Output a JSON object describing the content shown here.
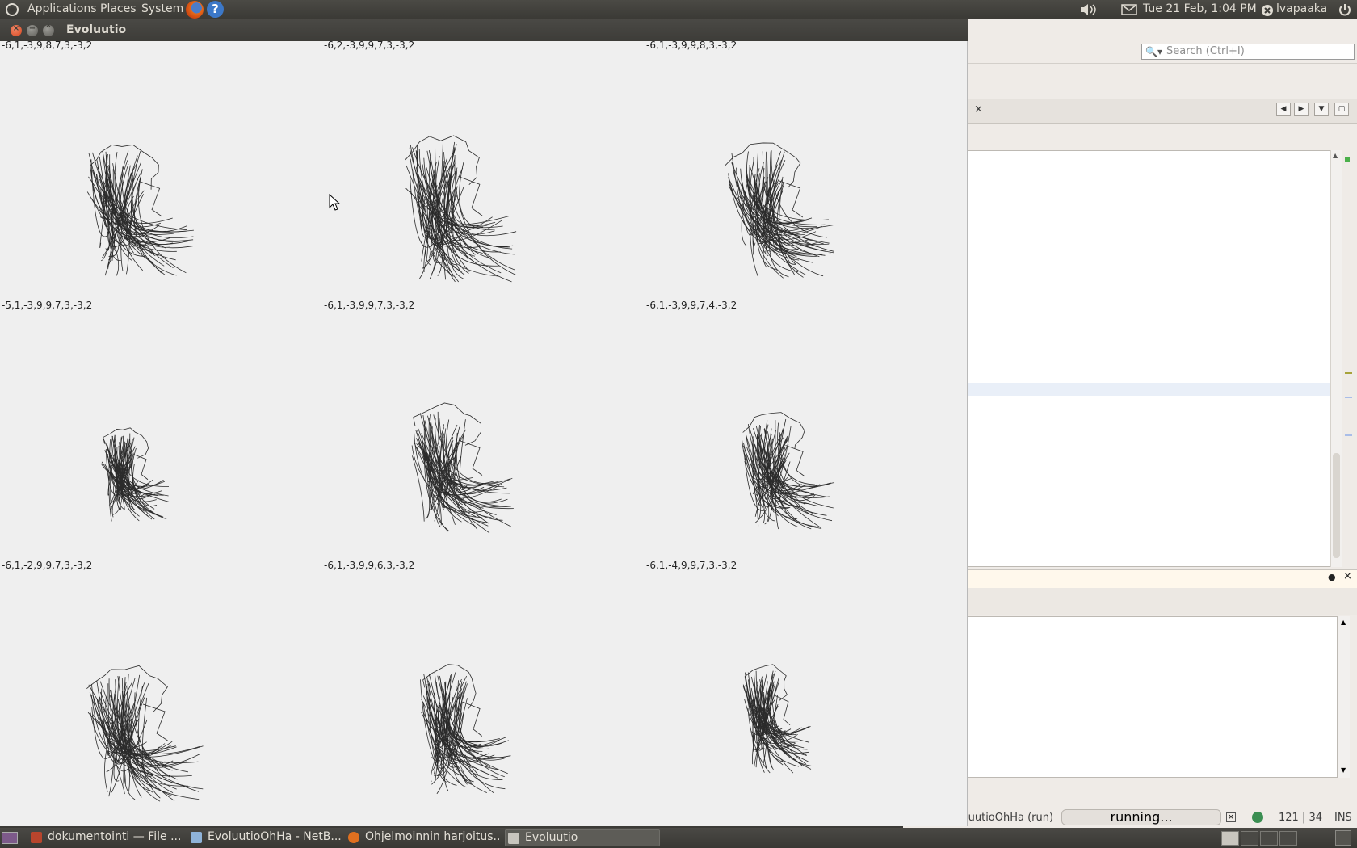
{
  "top_panel": {
    "menus": [
      "Applications",
      "Places",
      "System"
    ],
    "help_glyph": "?",
    "clock": "Tue 21 Feb,  1:04 PM",
    "user": "lvapaaka",
    "icons": [
      "ubuntu-logo-icon",
      "firefox-icon",
      "help-icon",
      "volume-icon",
      "mail-icon",
      "user-status-icon",
      "power-icon"
    ]
  },
  "evoluutio": {
    "title": "Evoluutio",
    "cells": [
      {
        "label": "-6,1,-3,9,8,7,3,-3,2"
      },
      {
        "label": "-6,2,-3,9,9,7,3,-3,2"
      },
      {
        "label": "-6,1,-3,9,9,8,3,-3,2"
      },
      {
        "label": "-5,1,-3,9,9,7,3,-3,2"
      },
      {
        "label": "-6,1,-3,9,9,7,3,-3,2"
      },
      {
        "label": "-6,1,-3,9,9,7,4,-3,2"
      },
      {
        "label": "-6,1,-2,9,9,7,3,-3,2"
      },
      {
        "label": "-6,1,-3,9,9,6,3,-3,2"
      },
      {
        "label": "-6,1,-4,9,9,7,3,-3,2"
      }
    ]
  },
  "netbeans": {
    "search_placeholder": "Search (Ctrl+I)",
    "tab_close": "×",
    "output_close": "×",
    "run_label": "luutioOhHa (run)",
    "progress_text": "running...",
    "cursor_position": "121 | 34",
    "insert_mode": "INS"
  },
  "taskbar": {
    "tasks": [
      {
        "label": "dokumentointi — File ..."
      },
      {
        "label": "EvoluutioOhHa - NetB..."
      },
      {
        "label": "Ohjelmoinnin harjoitus..."
      },
      {
        "label": "Evoluutio"
      }
    ]
  }
}
